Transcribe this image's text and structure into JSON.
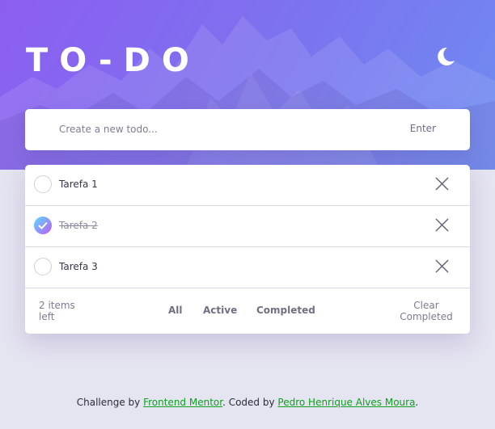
{
  "header": {
    "title": "TO-DO",
    "theme_icon": "moon-icon"
  },
  "new_todo": {
    "placeholder": "Create a new todo...",
    "value": "",
    "enter_label": "Enter"
  },
  "todos": [
    {
      "label": "Tarefa 1",
      "completed": false
    },
    {
      "label": "Tarefa 2",
      "completed": true
    },
    {
      "label": "Tarefa 3",
      "completed": false
    }
  ],
  "footer": {
    "items_left": "2 items left",
    "filters": [
      {
        "label": "All"
      },
      {
        "label": "Active"
      },
      {
        "label": "Completed"
      }
    ],
    "clear_label": "Clear Completed"
  },
  "attribution": {
    "prefix": "Challenge by ",
    "link1": "Frontend Mentor",
    "middle": ". Coded by ",
    "link2": "Pedro Henrique Alves Moura",
    "suffix": "."
  },
  "colors": {
    "hero_start": "#8c5ef0",
    "hero_end": "#6e8cf2",
    "check_gradient_start": "#57ddff",
    "check_gradient_end": "#c058f3",
    "page_bg": "#e5e4f1",
    "link": "#0fa020"
  }
}
